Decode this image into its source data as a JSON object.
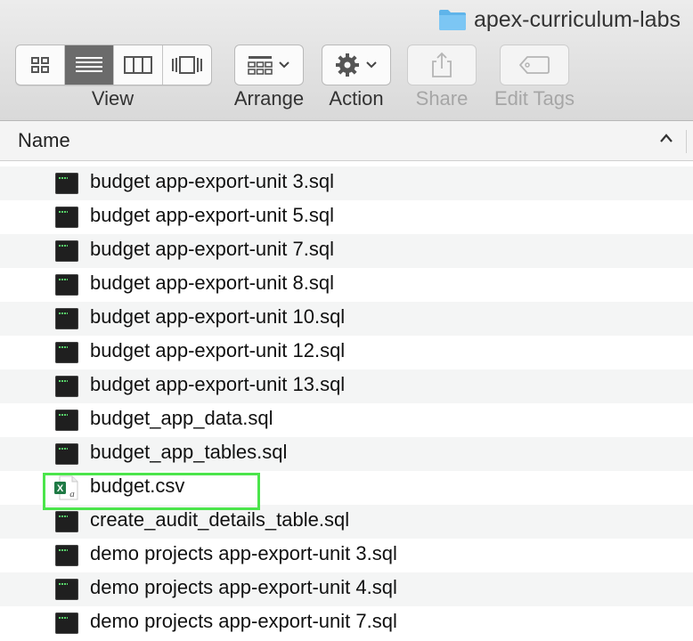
{
  "window": {
    "title": "apex-curriculum-labs",
    "folder_icon": "folder-icon"
  },
  "toolbar": {
    "view_label": "View",
    "arrange_label": "Arrange",
    "action_label": "Action",
    "share_label": "Share",
    "edit_tags_label": "Edit Tags",
    "view_modes": [
      "icon-view",
      "list-view",
      "column-view",
      "cover-flow-view"
    ],
    "active_view": "list-view"
  },
  "list": {
    "column_header": "Name",
    "sort_direction": "ascending",
    "files": [
      {
        "name": "budget app-export-unit 3.sql",
        "type": "sql"
      },
      {
        "name": "budget app-export-unit 5.sql",
        "type": "sql"
      },
      {
        "name": "budget app-export-unit 7.sql",
        "type": "sql"
      },
      {
        "name": "budget app-export-unit 8.sql",
        "type": "sql"
      },
      {
        "name": "budget app-export-unit 10.sql",
        "type": "sql"
      },
      {
        "name": "budget app-export-unit 12.sql",
        "type": "sql"
      },
      {
        "name": "budget app-export-unit 13.sql",
        "type": "sql"
      },
      {
        "name": "budget_app_data.sql",
        "type": "sql"
      },
      {
        "name": "budget_app_tables.sql",
        "type": "sql"
      },
      {
        "name": "budget.csv",
        "type": "csv"
      },
      {
        "name": "create_audit_details_table.sql",
        "type": "sql"
      },
      {
        "name": "demo projects app-export-unit 3.sql",
        "type": "sql"
      },
      {
        "name": "demo projects app-export-unit 4.sql",
        "type": "sql"
      },
      {
        "name": "demo projects app-export-unit 7.sql",
        "type": "sql"
      }
    ],
    "highlighted_file": "budget.csv",
    "highlight_color": "#4be54b"
  }
}
